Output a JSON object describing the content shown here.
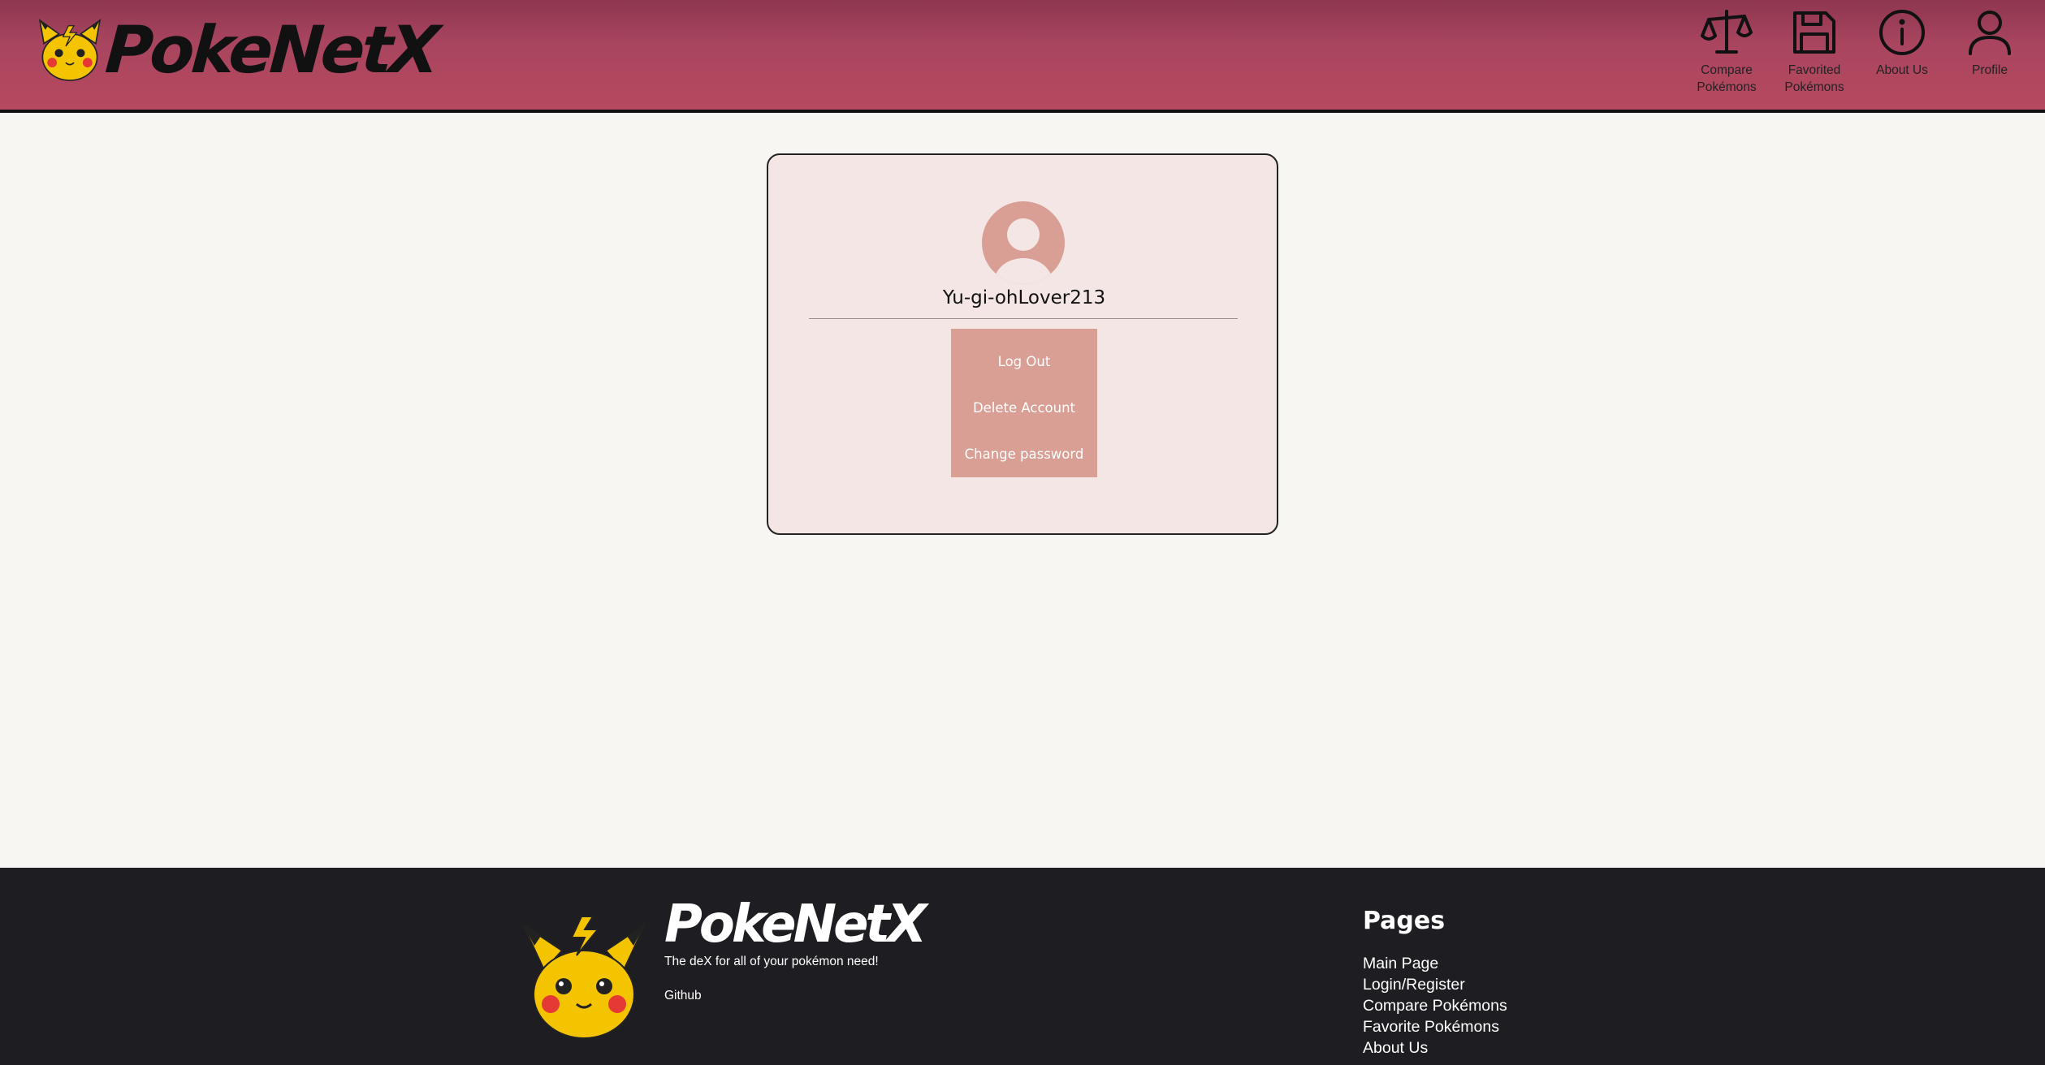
{
  "header": {
    "brand": "PokeNetX",
    "nav": [
      {
        "label": "Compare Pokémons",
        "icon": "scale-icon"
      },
      {
        "label": "Favorited Pokémons",
        "icon": "save-icon"
      },
      {
        "label": "About Us",
        "icon": "info-icon"
      },
      {
        "label": "Profile",
        "icon": "user-icon"
      }
    ]
  },
  "profile": {
    "username": "Yu-gi-ohLover213",
    "actions": {
      "logout": "Log Out",
      "delete": "Delete Account",
      "change_password": "Change password"
    }
  },
  "footer": {
    "brand": "PokeNetX",
    "tagline": "The deX for all of your pokémon need!",
    "github": "Github",
    "pages_title": "Pages",
    "links": [
      "Main Page",
      "Login/Register",
      "Compare Pokémons",
      "Favorite Pokémons",
      "About Us"
    ]
  },
  "colors": {
    "header": "#b6495f",
    "card": "#f3e6e4",
    "accent": "#d99e94",
    "footer": "#1e1d22",
    "background": "#f8f6f2"
  }
}
